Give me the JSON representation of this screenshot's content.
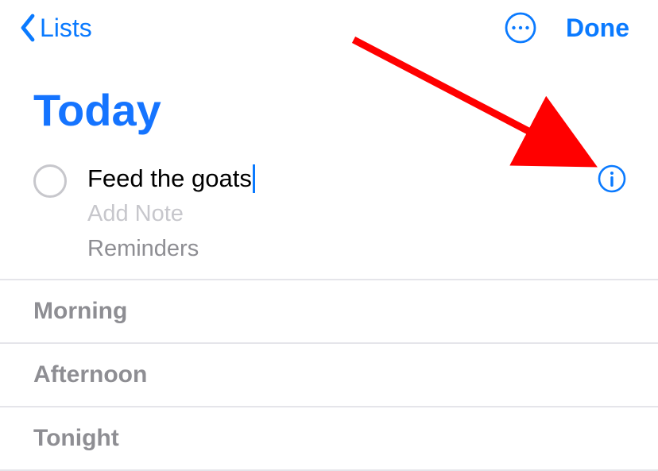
{
  "header": {
    "back_label": "Lists",
    "done_label": "Done"
  },
  "title": "Today",
  "reminder": {
    "title": "Feed the goats",
    "note_placeholder": "Add Note",
    "list_name": "Reminders"
  },
  "sections": [
    {
      "label": "Morning"
    },
    {
      "label": "Afternoon"
    },
    {
      "label": "Tonight"
    }
  ],
  "colors": {
    "accent": "#0a7aff",
    "title": "#1574ff",
    "secondary": "#8e8e93",
    "placeholder": "#c7c7cc",
    "annotation": "#ff0000"
  }
}
